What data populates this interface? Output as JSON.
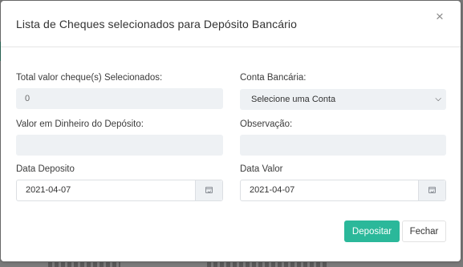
{
  "modal": {
    "title": "Lista de Cheques selecionados para Depósito Bancário",
    "close_glyph": "×"
  },
  "form": {
    "total_label": "Total valor cheque(s) Selecionados:",
    "total_value": "0",
    "conta_label": "Conta Bancária:",
    "conta_selected": "Selecione uma Conta",
    "dinheiro_label": "Valor em Dinheiro do Depósito:",
    "dinheiro_value": "",
    "observacao_label": "Observação:",
    "observacao_value": "",
    "data_deposito_label": "Data Deposito",
    "data_deposito_value": "2021-04-07",
    "data_valor_label": "Data Valor",
    "data_valor_value": "2021-04-07"
  },
  "actions": {
    "depositar_label": "Depositar",
    "fechar_label": "Fechar"
  },
  "colors": {
    "primary": "#2bb89a",
    "input_bg": "#eef1f4"
  },
  "icons": {
    "close": "close-icon",
    "calendar": "calendar-icon",
    "select_arrow": "chevron-down-icon"
  }
}
